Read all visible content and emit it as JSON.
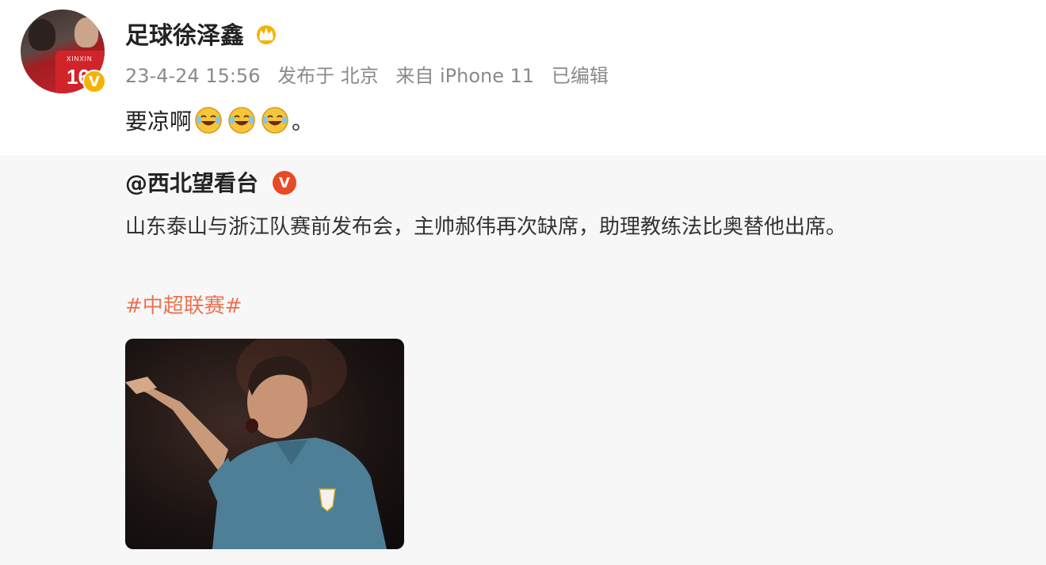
{
  "post": {
    "author": "足球徐泽鑫",
    "meta": {
      "date": "23-4-24 15:56",
      "published_at": "发布于 北京",
      "source": "来自 iPhone 11",
      "edited": "已编辑"
    },
    "text": "要凉啊",
    "text_end": "。",
    "emoji_count": 3
  },
  "repost": {
    "author": "@西北望看台",
    "text": "山东泰山与浙江队赛前发布会，主帅郝伟再次缺席，助理教练法比奥替他出席。",
    "hashtag": "#中超联赛#"
  },
  "avatar": {
    "jersey_name": "XINXIN",
    "jersey_number": "16",
    "badge_letter": "V"
  },
  "repost_badge_letter": "V",
  "colors": {
    "hashtag": "#eb7350",
    "meta": "#8a8a8a",
    "verified_gold": "#f5b301",
    "verified_red": "#e84a23",
    "repost_bg": "#f7f7f7"
  }
}
